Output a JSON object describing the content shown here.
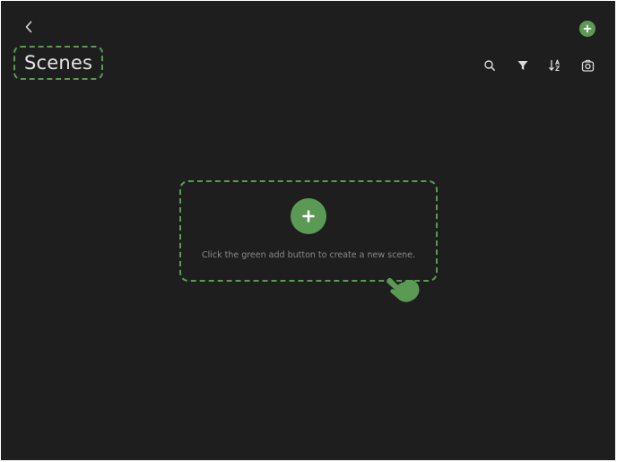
{
  "header": {
    "title": "Scenes"
  },
  "icons": {
    "back": "chevron-left-icon",
    "add": "plus-icon",
    "search": "search-icon",
    "filter": "filter-icon",
    "sort": "sort-az-icon",
    "camera": "camera-icon",
    "hand": "hand-pointer-icon"
  },
  "empty_state": {
    "hint": "Click the green add button to create a new scene."
  },
  "colors": {
    "background": "#1e1e1e",
    "accent": "#5a9a55",
    "text": "#e4e4e4",
    "hint_text": "#8a8a8a"
  }
}
